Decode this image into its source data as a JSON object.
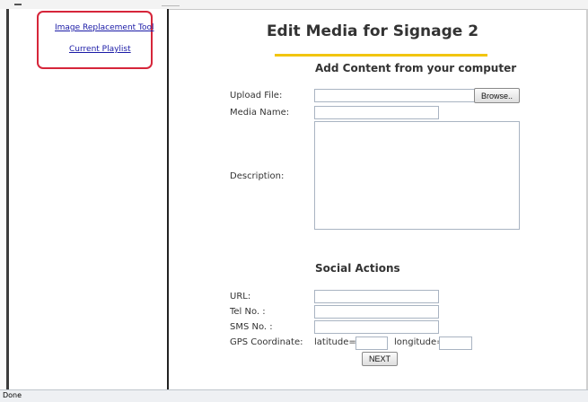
{
  "sidebar": {
    "links": [
      {
        "label": "Image Replacement Tool"
      },
      {
        "label": "Current Playlist"
      }
    ]
  },
  "main": {
    "title": "Edit Media for Signage 2",
    "upload_section": {
      "heading": "Add Content from your computer",
      "upload_file_label": "Upload File:",
      "upload_file_value": "",
      "browse_label": "Browse..",
      "media_name_label": "Media Name:",
      "media_name_value": "",
      "description_label": "Description:",
      "description_value": ""
    },
    "social_section": {
      "heading": "Social Actions",
      "url_label": "URL:",
      "url_value": "",
      "tel_label": "Tel No. :",
      "tel_value": "",
      "sms_label": "SMS No. :",
      "sms_value": "",
      "gps_label": "GPS Coordinate:",
      "latitude_label": "latitude=",
      "latitude_value": "",
      "longitude_label": "longitude=",
      "longitude_value": "",
      "next_label": "NEXT"
    }
  },
  "status_bar": {
    "text": "Done"
  },
  "colors": {
    "link": "#1a1aa6",
    "highlight_border": "#d6263a",
    "title_underline": "#f2c50f",
    "text": "#333333"
  }
}
